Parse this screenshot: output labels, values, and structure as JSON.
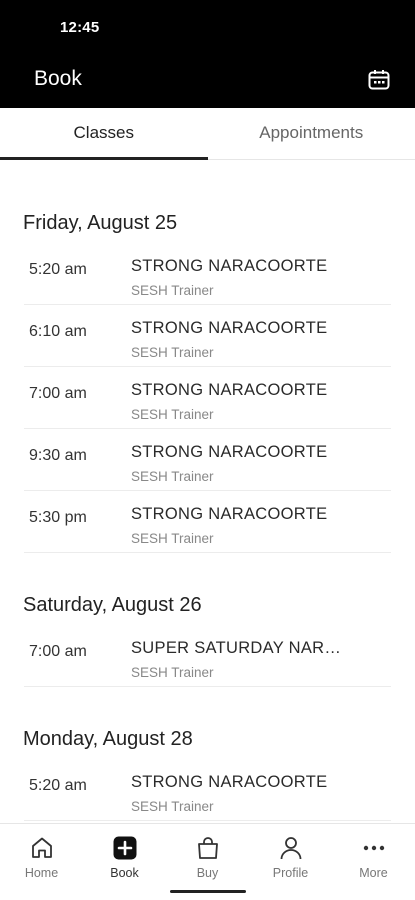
{
  "status_bar": {
    "time": "12:45"
  },
  "app_bar": {
    "title": "Book",
    "action_icon": "calendar-icon"
  },
  "tabs": [
    {
      "label": "Classes",
      "active": true
    },
    {
      "label": "Appointments",
      "active": false
    }
  ],
  "days": [
    {
      "date": "Friday, August 25",
      "classes": [
        {
          "time": "5:20 am",
          "name": "STRONG NARACOORTE",
          "subtitle": "SESH Trainer"
        },
        {
          "time": "6:10 am",
          "name": "STRONG NARACOORTE",
          "subtitle": "SESH Trainer"
        },
        {
          "time": "7:00 am",
          "name": "STRONG NARACOORTE",
          "subtitle": "SESH Trainer"
        },
        {
          "time": "9:30 am",
          "name": "STRONG NARACOORTE",
          "subtitle": "SESH Trainer"
        },
        {
          "time": "5:30 pm",
          "name": "STRONG NARACOORTE",
          "subtitle": "SESH Trainer"
        }
      ]
    },
    {
      "date": "Saturday, August 26",
      "classes": [
        {
          "time": "7:00 am",
          "name": "SUPER SATURDAY NAR…",
          "subtitle": "SESH Trainer"
        }
      ]
    },
    {
      "date": "Monday, August 28",
      "classes": [
        {
          "time": "5:20 am",
          "name": "STRONG NARACOORTE",
          "subtitle": "SESH Trainer"
        }
      ]
    }
  ],
  "bottom_nav": [
    {
      "label": "Home",
      "icon": "home-icon",
      "active": false
    },
    {
      "label": "Book",
      "icon": "book-plus-icon",
      "active": true
    },
    {
      "label": "Buy",
      "icon": "shopping-bag-icon",
      "active": false
    },
    {
      "label": "Profile",
      "icon": "person-icon",
      "active": false
    },
    {
      "label": "More",
      "icon": "more-dots-icon",
      "active": false
    }
  ]
}
